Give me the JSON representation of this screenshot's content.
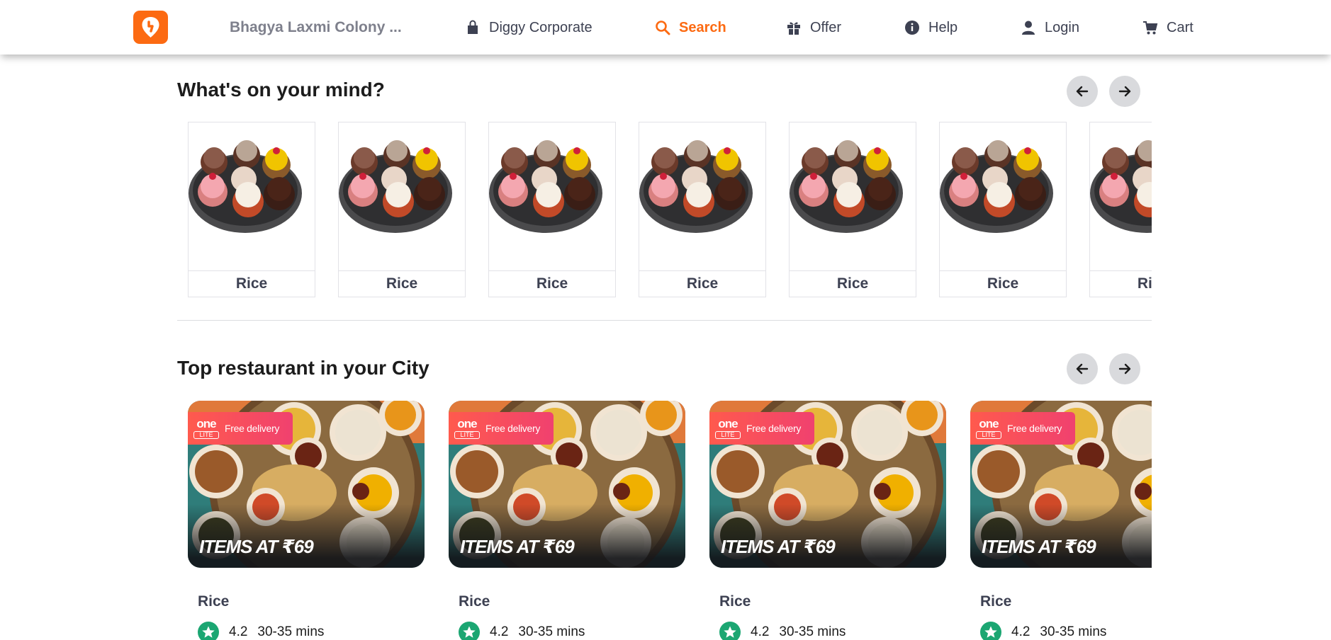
{
  "header": {
    "location": "Bhagya Laxmi Colony ...",
    "nav": [
      {
        "label": "Diggy Corporate",
        "icon": "bag-icon"
      },
      {
        "label": "Search",
        "icon": "search-icon",
        "active": true
      },
      {
        "label": "Offer",
        "icon": "gift-icon"
      },
      {
        "label": "Help",
        "icon": "info-icon"
      },
      {
        "label": "Login",
        "icon": "user-icon"
      },
      {
        "label": "Cart",
        "icon": "cart-icon"
      }
    ]
  },
  "colors": {
    "brand": "#fc6a12",
    "rating_green": "#1ba672",
    "promo": "#f0416f"
  },
  "mind": {
    "title": "What's on your mind?",
    "items": [
      {
        "label": "Rice",
        "image": "cupcakes"
      },
      {
        "label": "Rice",
        "image": "cupcakes"
      },
      {
        "label": "Rice",
        "image": "cupcakes"
      },
      {
        "label": "Rice",
        "image": "cupcakes"
      },
      {
        "label": "Rice",
        "image": "cupcakes"
      },
      {
        "label": "Rice",
        "image": "cupcakes"
      },
      {
        "label": "Rice",
        "image": "cupcakes"
      }
    ]
  },
  "restaurants": {
    "title": "Top restaurant in your City",
    "items": [
      {
        "name": "Rice",
        "rating": "4.2",
        "time": "30-35 mins",
        "offer": "ITEMS AT ₹69",
        "promo_brand": "one",
        "promo_tier": "LITE",
        "promo_text": "Free delivery"
      },
      {
        "name": "Rice",
        "rating": "4.2",
        "time": "30-35 mins",
        "offer": "ITEMS AT ₹69",
        "promo_brand": "one",
        "promo_tier": "LITE",
        "promo_text": "Free delivery"
      },
      {
        "name": "Rice",
        "rating": "4.2",
        "time": "30-35 mins",
        "offer": "ITEMS AT ₹69",
        "promo_brand": "one",
        "promo_tier": "LITE",
        "promo_text": "Free delivery"
      },
      {
        "name": "Rice",
        "rating": "4.2",
        "time": "30-35 mins",
        "offer": "ITEMS AT ₹69",
        "promo_brand": "one",
        "promo_tier": "LITE",
        "promo_text": "Free delivery"
      }
    ]
  }
}
